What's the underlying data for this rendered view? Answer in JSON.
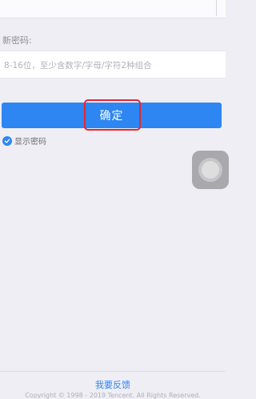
{
  "form": {
    "new_password_label": "新密码:",
    "new_password_placeholder": "8-16位，至少含数字/字母/字符2种组合",
    "new_password_value": "",
    "confirm_label": "确定",
    "show_password_label": "显示密码",
    "show_password_checked": true
  },
  "footer": {
    "feedback_label": "我要反馈",
    "copyright": "Copyright © 1998 - 2019 Tencent. All Rights Reserved."
  },
  "colors": {
    "accent": "#2d86f1",
    "highlight": "#e8262c",
    "background": "#efeef4"
  },
  "icons": {
    "checkbox": "check-circle-icon",
    "floating": "assistive-touch-icon"
  }
}
